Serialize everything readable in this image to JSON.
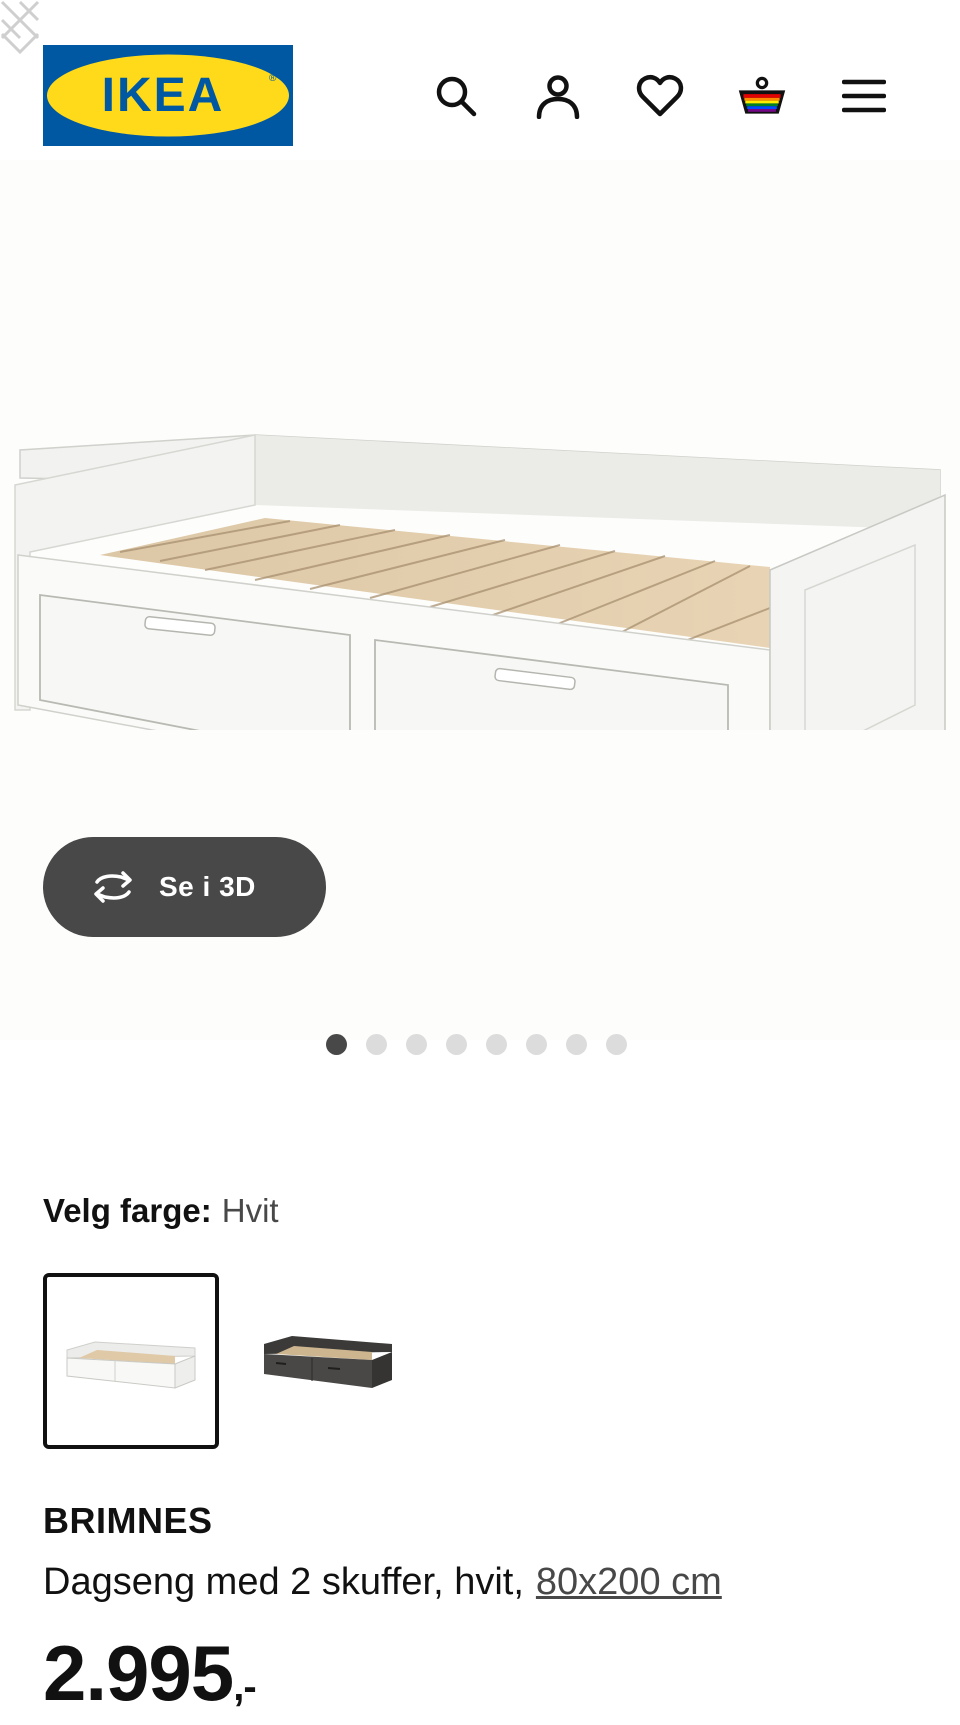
{
  "header": {
    "logo_text": "IKEA",
    "icons": [
      "search-icon",
      "user-icon",
      "heart-icon",
      "basket-icon",
      "menu-icon"
    ]
  },
  "gallery": {
    "view_3d_label": "Se i 3D",
    "dot_count": 8,
    "active_dot": 1
  },
  "color_select": {
    "label": "Velg farge:",
    "selected_value": "Hvit"
  },
  "product": {
    "name": "BRIMNES",
    "description": "Dagseng med 2 skuffer, hvit,",
    "size": "80x200 cm",
    "price_main": "2.995",
    "price_suffix": ",-"
  },
  "colors": {
    "ikea_blue": "#0058a3",
    "ikea_yellow": "#ffda1a",
    "button_dark": "#484848"
  }
}
